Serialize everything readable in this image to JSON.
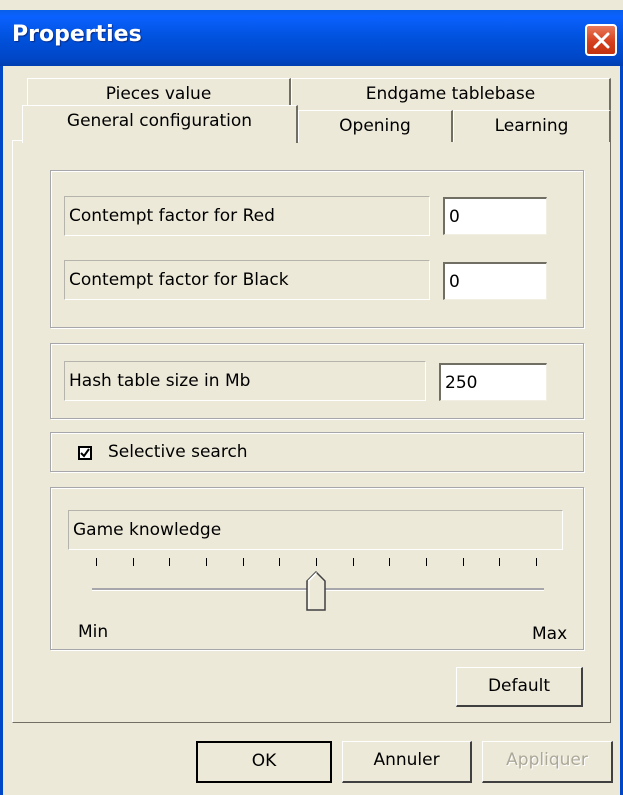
{
  "window": {
    "title": "Properties",
    "close_icon": "close-icon"
  },
  "tabs": {
    "row_back": [
      {
        "label": "Pieces value"
      },
      {
        "label": "Endgame tablebase"
      }
    ],
    "row_front": [
      {
        "label": "General configuration",
        "active": true
      },
      {
        "label": "Opening"
      },
      {
        "label": "Learning"
      }
    ]
  },
  "contempt": {
    "red_label": "Contempt factor for Red",
    "red_value": "0",
    "black_label": "Contempt factor for Black",
    "black_value": "0"
  },
  "hash": {
    "label": "Hash table size in Mb",
    "value": "250"
  },
  "selective": {
    "label": "Selective search",
    "checked": true
  },
  "knowledge": {
    "label": "Game knowledge",
    "min_label": "Min",
    "max_label": "Max",
    "slider_position_fraction": 0.5,
    "tick_count": 13
  },
  "buttons": {
    "default_label": "Default",
    "ok_label": "OK",
    "cancel_label": "Annuler",
    "apply_label": "Appliquer"
  },
  "colors": {
    "titlebar": "#0153e0",
    "face": "#ece9d8",
    "close": "#d5401e"
  }
}
